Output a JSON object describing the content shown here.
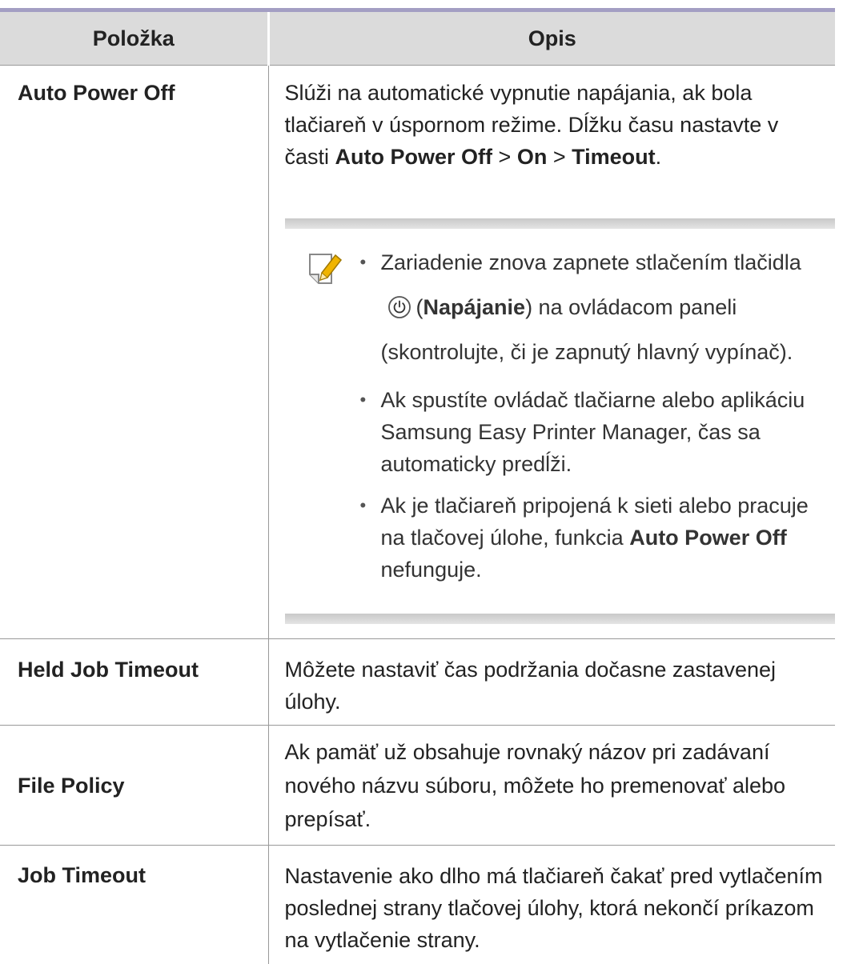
{
  "table": {
    "headers": {
      "item": "Položka",
      "description": "Opis"
    },
    "auto_power_off": {
      "item": "Auto Power Off",
      "desc_1": "Slúži na automatické vypnutie napájania, ak bola tlačiareň v úspornom režime. Dĺžku času nastavte v časti ",
      "path_1": "Auto Power Off",
      "sep_1": " > ",
      "path_2": "On",
      "sep_2": " > ",
      "path_3": "Timeout",
      "end": ".",
      "note": {
        "icon": "note-pencil-icon",
        "bullet_1_a": "Zariadenie znova zapnete stlačením tlačidla",
        "bullet_1_icon": "power-icon",
        "bullet_1_open": "(",
        "bullet_1_bold": "Napájanie",
        "bullet_1_b": ") na ovládacom paneli (skontrolujte, či je zapnutý hlavný vypínač).",
        "bullet_2": "Ak spustíte ovládač tlačiarne alebo aplikáciu Samsung Easy Printer Manager, čas sa automaticky predĺži.",
        "bullet_3_a": "Ak je tlačiareň pripojená k sieti alebo pracuje na tlačovej úlohe, funkcia ",
        "bullet_3_bold": "Auto Power Off",
        "bullet_3_b": " nefunguje."
      }
    },
    "held_job_timeout": {
      "item": "Held Job Timeout",
      "description": "Môžete nastaviť čas podržania dočasne zastavenej úlohy."
    },
    "file_policy": {
      "item": "File Policy",
      "description": "Ak pamäť už obsahuje rovnaký názov pri zadávaní nového názvu súboru, môžete ho premenovať alebo prepísať."
    },
    "job_timeout": {
      "item": "Job Timeout",
      "description": "Nastavenie ako dlho má tlačiareň čakať pred vytlačením poslednej strany tlačovej úlohy, ktorá nekončí príkazom na vytlačenie strany."
    }
  },
  "colors": {
    "header_bg": "#dbdbdb",
    "header_top_border": "#a39ec3",
    "note_icon_pencil": "#f0b400"
  }
}
